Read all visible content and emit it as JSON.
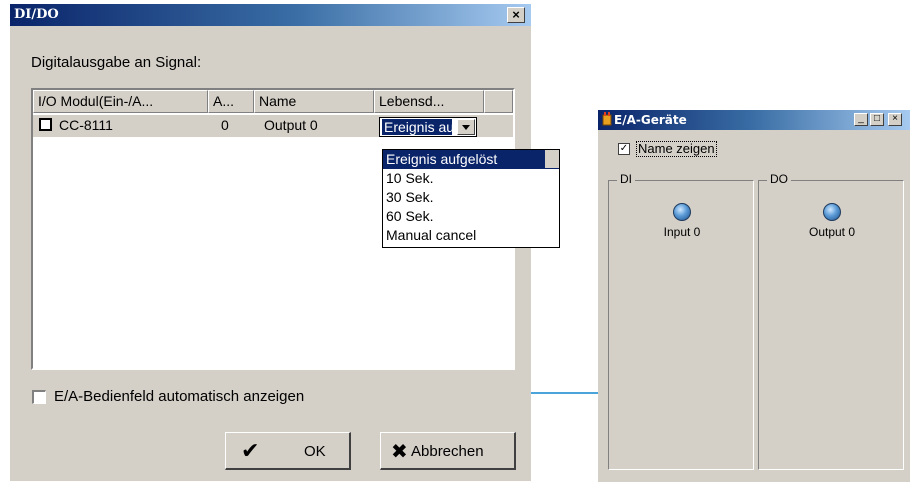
{
  "dialog": {
    "title": "DI/DO",
    "close_glyph": "×",
    "signal_label": "Digitalausgabe an Signal:",
    "columns": [
      "I/O Modul(Ein-/A...",
      "A...",
      "Name",
      "Lebensd..."
    ],
    "row": {
      "module": "CC-8111",
      "address": "0",
      "name": "Output 0",
      "lifetime_selected": "Ereignis aufgelöst"
    },
    "lifetime_options": [
      "Ereignis aufgelöst",
      "10 Sek.",
      "30 Sek.",
      "60 Sek.",
      "Manual cancel"
    ],
    "auto_show_label": "E/A-Bedienfeld automatisch anzeigen",
    "ok_label": "OK",
    "cancel_label": "Abbrechen",
    "ok_icon": "checkmark-icon",
    "cancel_icon": "x-icon"
  },
  "panel": {
    "title": "E/A-Geräte",
    "show_names_label": "Name zeigen",
    "show_names_checked": true,
    "groups": [
      {
        "label": "DI",
        "item": "Input 0"
      },
      {
        "label": "DO",
        "item": "Output 0"
      }
    ]
  },
  "colors": {
    "title_active": "#0a246a",
    "face": "#d4d0c8",
    "connector": "#4aa3d9"
  }
}
